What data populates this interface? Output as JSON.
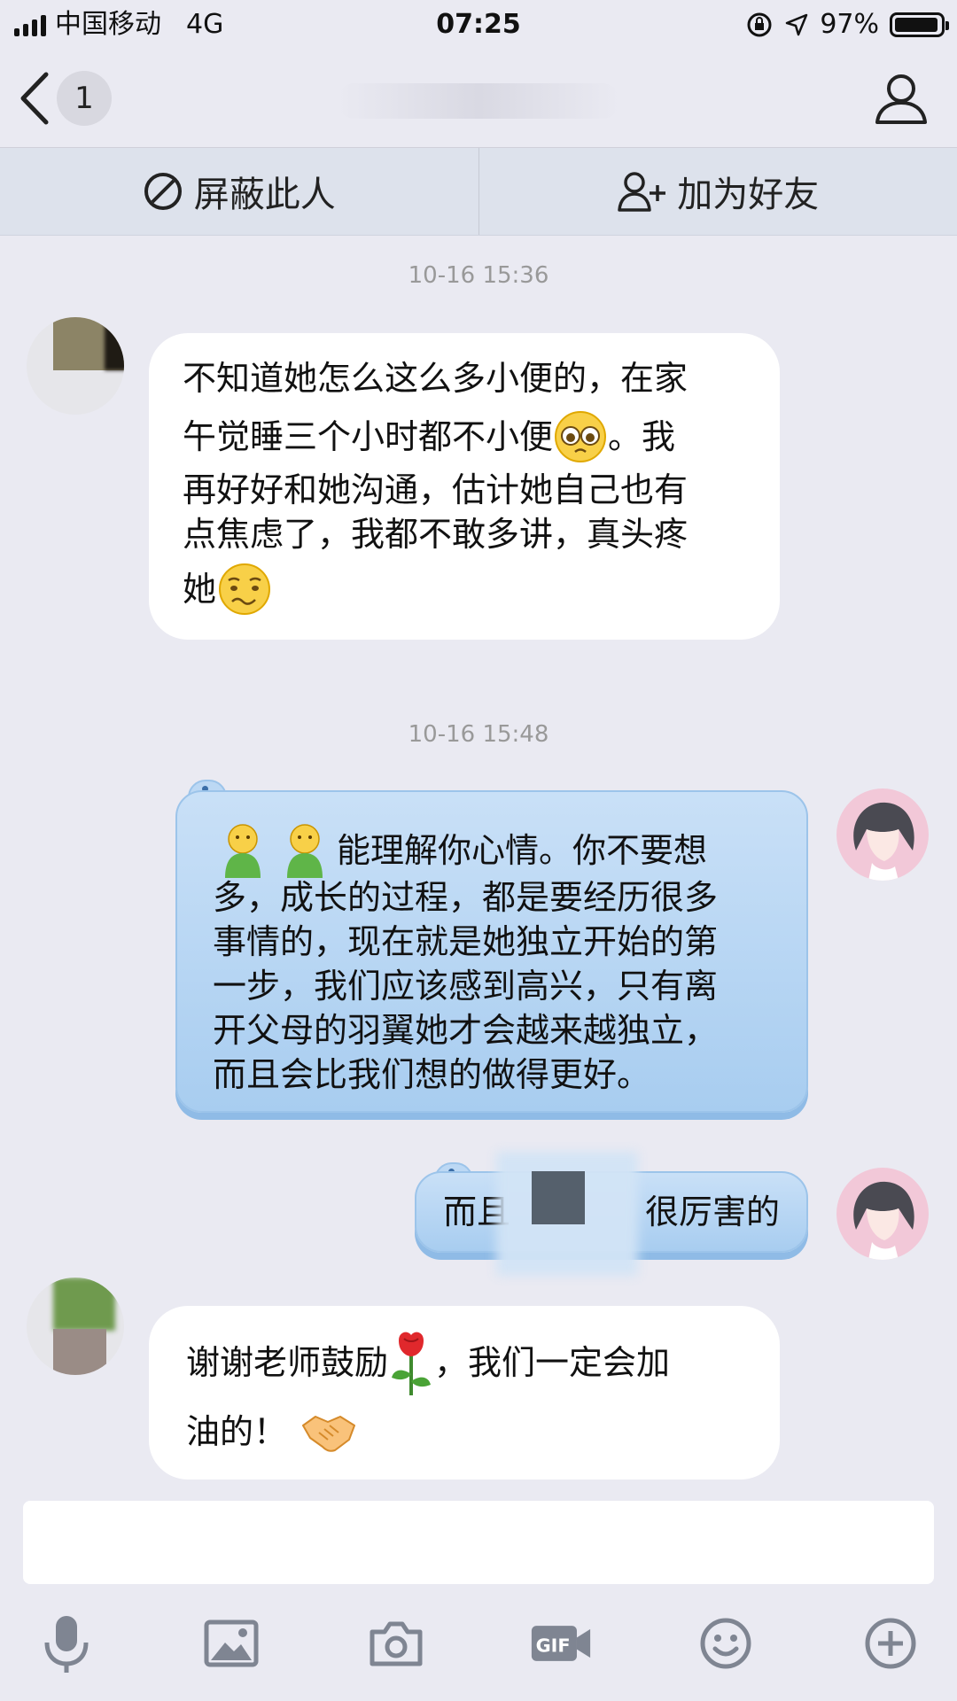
{
  "status_bar": {
    "carrier": "中国移动",
    "network": "4G",
    "time": "07:25",
    "battery": "97%"
  },
  "nav": {
    "unread_count": "1",
    "back_icon": "chevron-left-icon",
    "profile_icon": "user-outline-icon"
  },
  "actions": {
    "block_label": "屏蔽此人",
    "add_friend_label": "加为好友"
  },
  "messages": [
    {
      "timestamp": "10-16 15:36",
      "side": "left",
      "lines": [
        "不知道她怎么这么多小便的，在家",
        "午觉睡三个小时都不小便",
        "。我",
        "再好好和她沟通，估计她自己也有",
        "点焦虑了，我都不敢多讲，真头疼",
        "她"
      ]
    },
    {
      "timestamp": "10-16 15:48",
      "side": "right",
      "lines": [
        "能理解你心情。你不要想",
        "多，成长的过程，都是要经历很多",
        "事情的，现在就是她独立开始的第",
        "一步，我们应该感到高兴，只有离",
        "开父母的羽翼她才会越来越独立，",
        "而且会比我们想的做得更好。"
      ]
    },
    {
      "side": "right",
      "text_start": "而且",
      "text_end": "很厉害的"
    },
    {
      "side": "left",
      "lines": [
        "谢谢老师鼓励",
        "，我们一定会加",
        "油的！"
      ]
    }
  ],
  "toolbar": {
    "icons": [
      "microphone-icon",
      "image-icon",
      "camera-icon",
      "gif-icon",
      "emoji-icon",
      "plus-circle-icon"
    ]
  },
  "colors": {
    "background": "#eaeaf2",
    "bubble_blue": "#b8d6f3",
    "bubble_white": "#ffffff",
    "timestamp": "#999999"
  }
}
